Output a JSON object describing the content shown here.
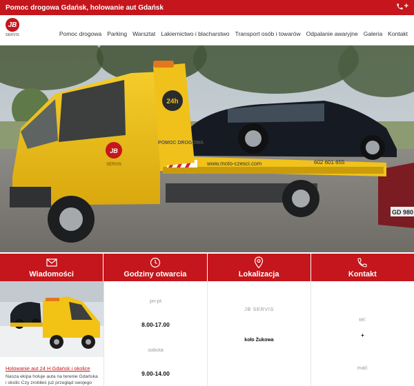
{
  "topbar": {
    "title": "Pomoc drogowa Gdańsk, holowanie aut Gdańsk",
    "phone_icon": "phone-icon",
    "phone_plus": "+"
  },
  "logo": {
    "mark": "JB",
    "text": "SERVIS"
  },
  "nav": {
    "items": [
      {
        "label": "Pomoc drogowa"
      },
      {
        "label": "Parking"
      },
      {
        "label": "Warsztat"
      },
      {
        "label": "Lakiernictwo i blacharstwo"
      },
      {
        "label": "Transport osób i towarów"
      },
      {
        "label": "Odpalanie awaryjne"
      },
      {
        "label": "Galeria"
      },
      {
        "label": "Kontakt"
      }
    ]
  },
  "hero": {
    "sign_24h": "24h",
    "door_brand": "JB",
    "door_text": "SERVIS",
    "cab_text": "POMOC DROGOWA",
    "website": "www.moto-czesci.com",
    "phone_partial": "602 601 655",
    "plate": "GD 980"
  },
  "features": [
    {
      "label": "Wiadomości",
      "icon": "envelope-icon"
    },
    {
      "label": "Godziny otwarcia",
      "icon": "clock-icon"
    },
    {
      "label": "Lokalizacja",
      "icon": "map-pin-icon"
    },
    {
      "label": "Kontakt",
      "icon": "phone-icon"
    }
  ],
  "news": {
    "title": "Holowanie aut 24 H Gdańsk i okolice",
    "desc": "Nasza ekipa holuje auta na terenie Gdańska i okolic Czy zrobiłeś już przegląd swojego"
  },
  "hours": {
    "day1": "pn-pt",
    "hours1": "8.00-17.00",
    "day2": "sobota",
    "hours2": "9.00-14.00"
  },
  "location": {
    "company": "JB SERVIS",
    "place": "koło Żukowa"
  },
  "contact": {
    "tel_label": "tel:",
    "tel_value": "+",
    "mail_label": "mail:"
  },
  "colors": {
    "brand": "#c4161c",
    "truck": "#f2c215",
    "car": "#1a1d24"
  }
}
